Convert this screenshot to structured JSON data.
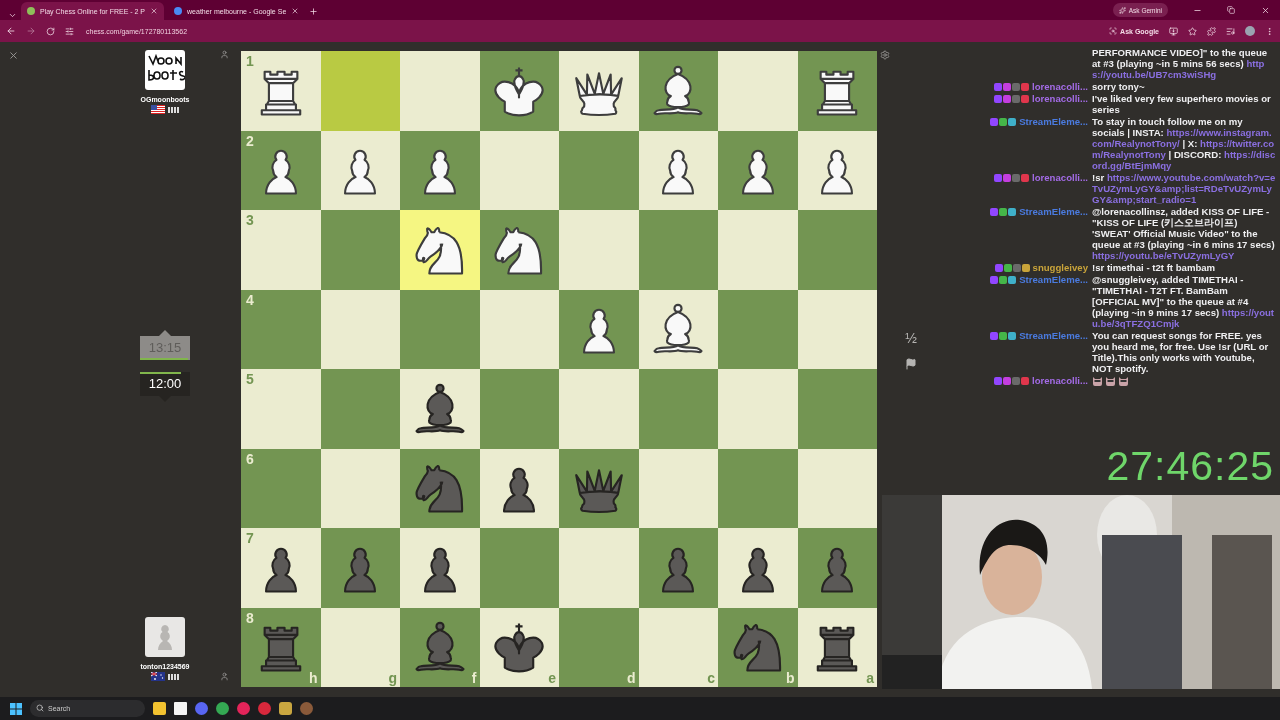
{
  "browser": {
    "tabs": [
      {
        "title": "Play Chess Online for FREE - 2 P",
        "selected": true
      },
      {
        "title": "weather melbourne - Google Se",
        "selected": false
      }
    ],
    "gemini": "Ask Gemini",
    "url": "chess.com/game/172780113562",
    "ask_google": "Ask Google"
  },
  "players": [
    {
      "name": "OGmoonboots",
      "flag": {
        "kind": "us"
      },
      "clock": {
        "time": "13:15",
        "active": false,
        "level": 0.95
      }
    },
    {
      "name": "tonton1234569",
      "flag": {
        "kind": "au"
      },
      "clock": {
        "time": "12:00",
        "active": true,
        "level": 0.82
      }
    }
  ],
  "board": {
    "ranks": [
      "1",
      "2",
      "3",
      "4",
      "5",
      "6",
      "7",
      "8"
    ],
    "files": [
      "h",
      "g",
      "f",
      "e",
      "d",
      "c",
      "b",
      "a"
    ],
    "rows": [
      [
        {
          "highlighted": false,
          "piece": {
            "kind": "rook",
            "color": "#f9f9f9"
          }
        },
        {
          "highlighted": true
        },
        {
          "highlighted": false
        },
        {
          "highlighted": false,
          "piece": {
            "kind": "king",
            "color": "#f9f9f9"
          }
        },
        {
          "highlighted": false,
          "piece": {
            "kind": "queen",
            "color": "#f9f9f9"
          }
        },
        {
          "highlighted": false,
          "piece": {
            "kind": "bishop",
            "color": "#f9f9f9"
          }
        },
        {
          "highlighted": false
        },
        {
          "highlighted": false,
          "piece": {
            "kind": "rook",
            "color": "#f9f9f9"
          }
        }
      ],
      [
        {
          "highlighted": false,
          "piece": {
            "kind": "pawn",
            "color": "#f9f9f9"
          }
        },
        {
          "highlighted": false,
          "piece": {
            "kind": "pawn",
            "color": "#f9f9f9"
          }
        },
        {
          "highlighted": false,
          "piece": {
            "kind": "pawn",
            "color": "#f9f9f9"
          }
        },
        {
          "highlighted": false
        },
        {
          "highlighted": false
        },
        {
          "highlighted": false,
          "piece": {
            "kind": "pawn",
            "color": "#f9f9f9"
          }
        },
        {
          "highlighted": false,
          "piece": {
            "kind": "pawn",
            "color": "#f9f9f9"
          }
        },
        {
          "highlighted": false,
          "piece": {
            "kind": "pawn",
            "color": "#f9f9f9"
          }
        }
      ],
      [
        {
          "highlighted": false
        },
        {
          "highlighted": false
        },
        {
          "highlighted": true,
          "piece": {
            "kind": "knight",
            "color": "#f9f9f9"
          }
        },
        {
          "highlighted": false,
          "piece": {
            "kind": "knight",
            "color": "#f9f9f9"
          }
        },
        {
          "highlighted": false
        },
        {
          "highlighted": false
        },
        {
          "highlighted": false
        },
        {
          "highlighted": false
        }
      ],
      [
        {
          "highlighted": false
        },
        {
          "highlighted": false
        },
        {
          "highlighted": false
        },
        {
          "highlighted": false
        },
        {
          "highlighted": false,
          "piece": {
            "kind": "pawn",
            "color": "#f9f9f9"
          }
        },
        {
          "highlighted": false,
          "piece": {
            "kind": "bishop",
            "color": "#f9f9f9"
          }
        },
        {
          "highlighted": false
        },
        {
          "highlighted": false
        }
      ],
      [
        {
          "highlighted": false
        },
        {
          "highlighted": false
        },
        {
          "highlighted": false,
          "piece": {
            "kind": "bishop",
            "color": "#5b5957"
          }
        },
        {
          "highlighted": false
        },
        {
          "highlighted": false
        },
        {
          "highlighted": false
        },
        {
          "highlighted": false
        },
        {
          "highlighted": false
        }
      ],
      [
        {
          "highlighted": false
        },
        {
          "highlighted": false
        },
        {
          "highlighted": false,
          "piece": {
            "kind": "knight",
            "color": "#5b5957"
          }
        },
        {
          "highlighted": false,
          "piece": {
            "kind": "pawn",
            "color": "#5b5957"
          }
        },
        {
          "highlighted": false,
          "piece": {
            "kind": "queen",
            "color": "#5b5957"
          }
        },
        {
          "highlighted": false
        },
        {
          "highlighted": false
        },
        {
          "highlighted": false
        }
      ],
      [
        {
          "highlighted": false,
          "piece": {
            "kind": "pawn",
            "color": "#5b5957"
          }
        },
        {
          "highlighted": false,
          "piece": {
            "kind": "pawn",
            "color": "#5b5957"
          }
        },
        {
          "highlighted": false,
          "piece": {
            "kind": "pawn",
            "color": "#5b5957"
          }
        },
        {
          "highlighted": false
        },
        {
          "highlighted": false
        },
        {
          "highlighted": false,
          "piece": {
            "kind": "pawn",
            "color": "#5b5957"
          }
        },
        {
          "highlighted": false,
          "piece": {
            "kind": "pawn",
            "color": "#5b5957"
          }
        },
        {
          "highlighted": false,
          "piece": {
            "kind": "pawn",
            "color": "#5b5957"
          }
        }
      ],
      [
        {
          "highlighted": false,
          "piece": {
            "kind": "rook",
            "color": "#5b5957"
          }
        },
        {
          "highlighted": false
        },
        {
          "highlighted": false,
          "piece": {
            "kind": "bishop",
            "color": "#5b5957"
          }
        },
        {
          "highlighted": false,
          "piece": {
            "kind": "king",
            "color": "#5b5957"
          }
        },
        {
          "highlighted": false
        },
        {
          "highlighted": false
        },
        {
          "highlighted": false,
          "piece": {
            "kind": "knight",
            "color": "#5b5957"
          }
        },
        {
          "highlighted": false,
          "piece": {
            "kind": "rook",
            "color": "#5b5957"
          }
        }
      ]
    ]
  },
  "draw_offer": "½",
  "chat": [
    {
      "parts": [
        {
          "kind": "text",
          "text": "PERFORMANCE VIDEO]\" to the queue at #3 (playing ~in 5 mins 56 secs) "
        },
        {
          "kind": "link",
          "text": "https://youtu.be/UB7cm3wiSHg"
        }
      ]
    },
    {
      "user": "lorenacolli...",
      "color": "#a36be6",
      "badges": [
        {
          "color": "#9146ff"
        },
        {
          "color": "#c43ee0"
        },
        {
          "color": "#6a6a6a"
        },
        {
          "color": "#e0364c"
        }
      ],
      "parts": [
        {
          "kind": "text",
          "text": "sorry tony~"
        }
      ]
    },
    {
      "user": "lorenacolli...",
      "color": "#a36be6",
      "badges": [
        {
          "color": "#9146ff"
        },
        {
          "color": "#c43ee0"
        },
        {
          "color": "#6a6a6a"
        },
        {
          "color": "#e0364c"
        }
      ],
      "parts": [
        {
          "kind": "text",
          "text": "I've liked very few superhero movies or series"
        }
      ]
    },
    {
      "user": "StreamEleme...",
      "color": "#4a7be0",
      "badges": [
        {
          "color": "#9146ff"
        },
        {
          "color": "#45b649"
        },
        {
          "color": "#3fb0c9"
        }
      ],
      "parts": [
        {
          "kind": "text",
          "text": "To stay in touch follow me on my socials | INSTA: "
        },
        {
          "kind": "link",
          "text": "https://www.instagram.com/RealynotTony/"
        },
        {
          "kind": "text",
          "text": " | X: "
        },
        {
          "kind": "link",
          "text": "https://twitter.com/RealynotTony"
        },
        {
          "kind": "text",
          "text": " | DISCORD: "
        },
        {
          "kind": "link",
          "text": "https://discord.gg/BtEjmMqy"
        }
      ]
    },
    {
      "user": "lorenacolli...",
      "color": "#a36be6",
      "badges": [
        {
          "color": "#9146ff"
        },
        {
          "color": "#c43ee0"
        },
        {
          "color": "#6a6a6a"
        },
        {
          "color": "#e0364c"
        }
      ],
      "parts": [
        {
          "kind": "text",
          "text": "!sr "
        },
        {
          "kind": "link",
          "text": "https://www.youtube.com/watch?v=eTvUZymLyGY&amp;list=RDeTvUZymLyGY&amp;start_radio=1"
        }
      ]
    },
    {
      "user": "StreamEleme...",
      "color": "#4a7be0",
      "badges": [
        {
          "color": "#9146ff"
        },
        {
          "color": "#45b649"
        },
        {
          "color": "#3fb0c9"
        }
      ],
      "parts": [
        {
          "kind": "mention",
          "text": "@lorenacollinsz"
        },
        {
          "kind": "text",
          "text": ", added KISS OF LIFE - \"KISS OF LIFE (키스오브라이프) 'SWEAT' Official Music Video\" to the queue at #3 (playing ~in 6 mins 17 secs) "
        },
        {
          "kind": "link",
          "text": "https://youtu.be/eTvUZymLyGY"
        }
      ]
    },
    {
      "user": "snuggleivey",
      "color": "#c9a43a",
      "badges": [
        {
          "color": "#9146ff"
        },
        {
          "color": "#45b649"
        },
        {
          "color": "#6a6a6a"
        },
        {
          "color": "#c9a43a"
        }
      ],
      "parts": [
        {
          "kind": "text",
          "text": "!sr timethai - t2t ft bambam"
        }
      ]
    },
    {
      "user": "StreamEleme...",
      "color": "#4a7be0",
      "badges": [
        {
          "color": "#9146ff"
        },
        {
          "color": "#45b649"
        },
        {
          "color": "#3fb0c9"
        }
      ],
      "parts": [
        {
          "kind": "mention",
          "text": "@snuggleivey"
        },
        {
          "kind": "text",
          "text": ", added TIMETHAI - \"TIMETHAI - T2T FT. BamBam [OFFICIAL MV]\" to the queue at #4 (playing ~in 9 mins 17 secs) "
        },
        {
          "kind": "link",
          "text": "https://youtu.be/3qTFZQ1Cmjk"
        }
      ]
    },
    {
      "user": "StreamEleme...",
      "color": "#4a7be0",
      "badges": [
        {
          "color": "#9146ff"
        },
        {
          "color": "#45b649"
        },
        {
          "color": "#3fb0c9"
        }
      ],
      "parts": [
        {
          "kind": "text",
          "text": "You can request songs for FREE. yes you heard me, for free. Use !sr (URL or Title).This only works with Youtube, NOT spotify."
        }
      ]
    },
    {
      "user": "lorenacolli...",
      "color": "#a36be6",
      "badges": [
        {
          "color": "#9146ff"
        },
        {
          "color": "#c43ee0"
        },
        {
          "color": "#6a6a6a"
        },
        {
          "color": "#e0364c"
        }
      ],
      "parts": [
        {
          "kind": "emote"
        },
        {
          "kind": "emote"
        },
        {
          "kind": "emote"
        }
      ]
    }
  ],
  "stream_timer": "27:46:25",
  "taskbar": {
    "search": {
      "placeholder": "Search"
    }
  }
}
